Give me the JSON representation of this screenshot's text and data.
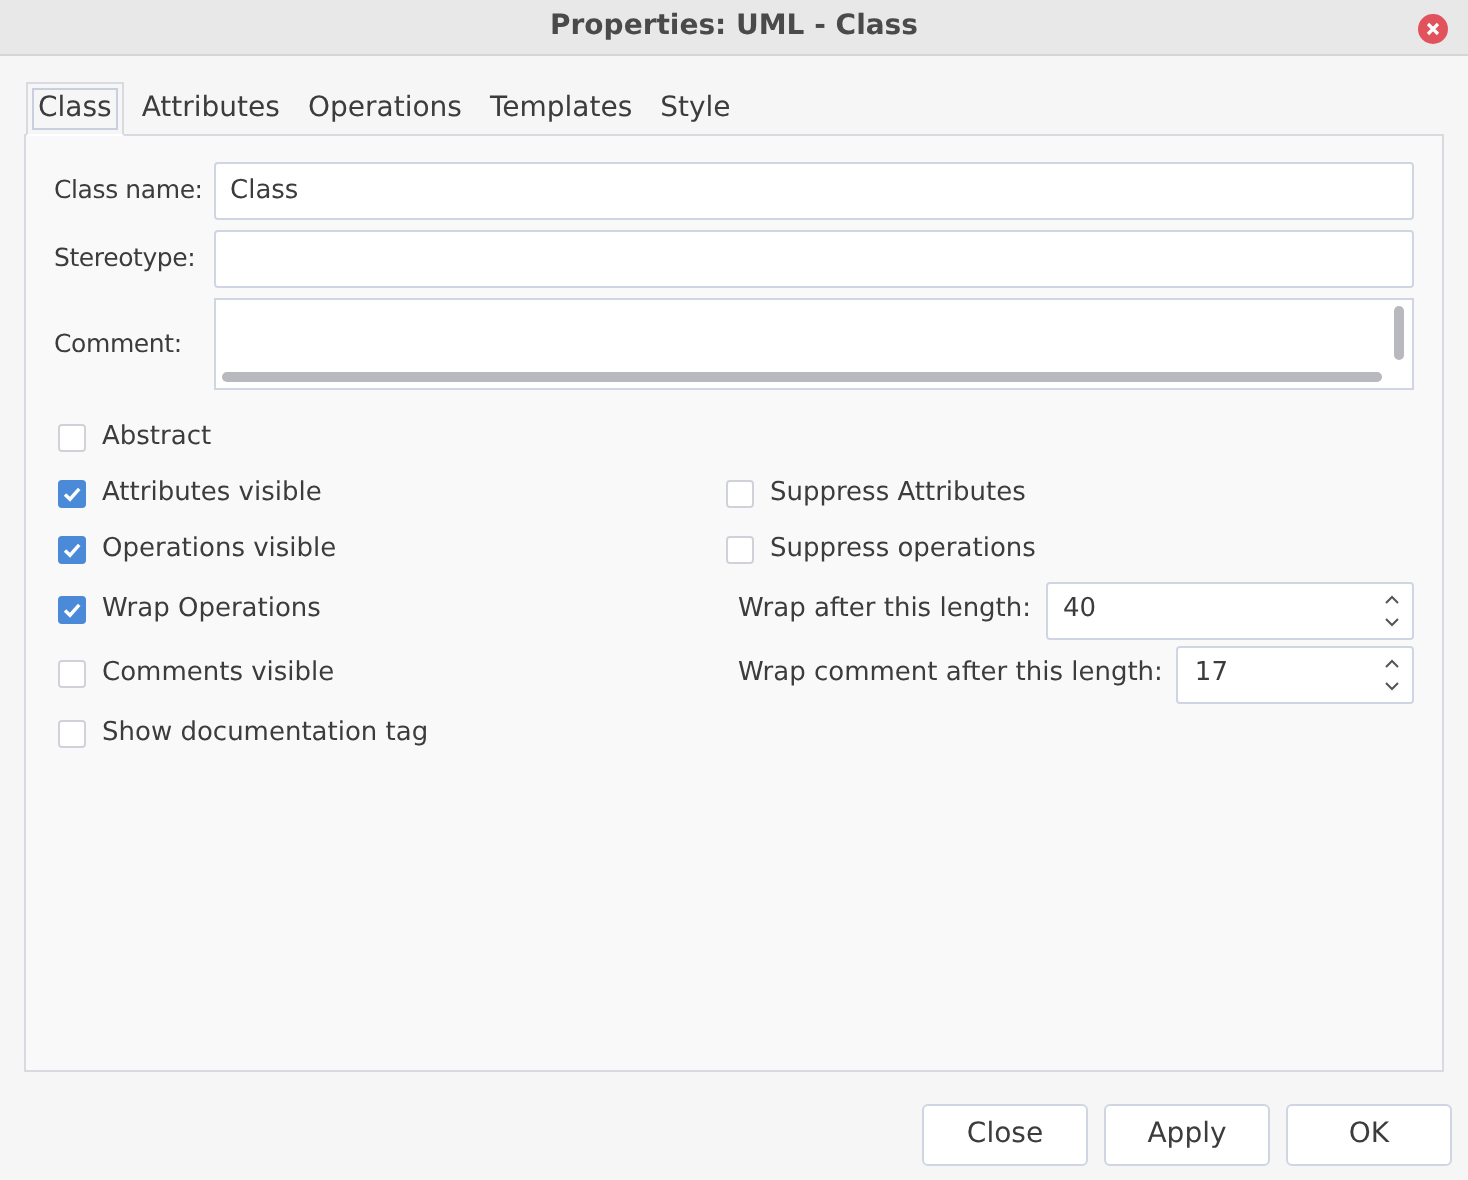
{
  "window": {
    "title": "Properties: UML - Class"
  },
  "tabs": [
    {
      "label": "Class",
      "selected": true
    },
    {
      "label": "Attributes",
      "selected": false
    },
    {
      "label": "Operations",
      "selected": false
    },
    {
      "label": "Templates",
      "selected": false
    },
    {
      "label": "Style",
      "selected": false
    }
  ],
  "fields": [
    {
      "kind": "line",
      "label": "Class name:",
      "value": "Class"
    },
    {
      "kind": "line",
      "label": "Stereotype:"
    },
    {
      "kind": "text",
      "label": "Comment:"
    }
  ],
  "rows": [
    {
      "left": {
        "label": "Abstract",
        "checked": false
      }
    },
    {
      "left": {
        "label": "Attributes visible",
        "checked": true
      },
      "right": {
        "kind": "checkbox",
        "label": "Suppress Attributes",
        "checked": false
      }
    },
    {
      "left": {
        "label": "Operations visible",
        "checked": true
      },
      "right": {
        "kind": "checkbox",
        "label": "Suppress operations",
        "checked": false
      }
    },
    {
      "left": {
        "label": "Wrap Operations",
        "checked": true
      },
      "right": {
        "kind": "spin",
        "label": "Wrap after this length:",
        "value": "40"
      }
    },
    {
      "left": {
        "label": "Comments visible",
        "checked": false
      },
      "right": {
        "kind": "spin",
        "label": "Wrap comment after this length:",
        "value": "17"
      }
    },
    {
      "left": {
        "label": "Show documentation tag",
        "checked": false
      }
    }
  ],
  "buttons": [
    "Close",
    "Apply",
    "OK"
  ]
}
